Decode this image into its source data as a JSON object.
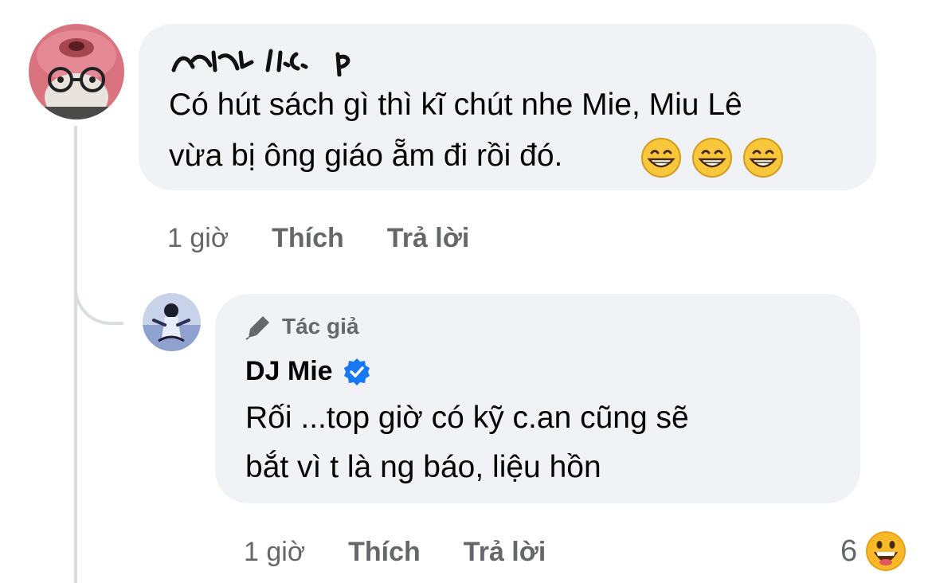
{
  "comments": [
    {
      "author_scribbled": true,
      "text_line1": "Có hút sách gì thì kĩ chút nhe Mie,  Miu Lê",
      "text_line2": "vừa bị ông giáo ẵm đi rồi đó.",
      "emoji_icons": [
        "grinning-face-icon",
        "grinning-face-icon",
        "grinning-face-icon"
      ],
      "time": "1 giờ",
      "like_label": "Thích",
      "reply_label": "Trả lời"
    },
    {
      "badge_label": "Tác giả",
      "badge_icon": "pen-icon",
      "author": "DJ Mie",
      "verified": true,
      "text_line1": "Rối ...top giờ có kỹ c.an cũng sẽ",
      "text_line2": "bắt vì t là ng báo, liệu hồn",
      "time": "1 giờ",
      "like_label": "Thích",
      "reply_label": "Trả lời",
      "reaction_count": "6",
      "reaction_icon": "laughing-face-icon"
    }
  ],
  "colors": {
    "bubble": "#f0f2f5",
    "text": "#050505",
    "secondary": "#65676b",
    "verified": "#1877f2",
    "thread_line": "#dadde1"
  }
}
